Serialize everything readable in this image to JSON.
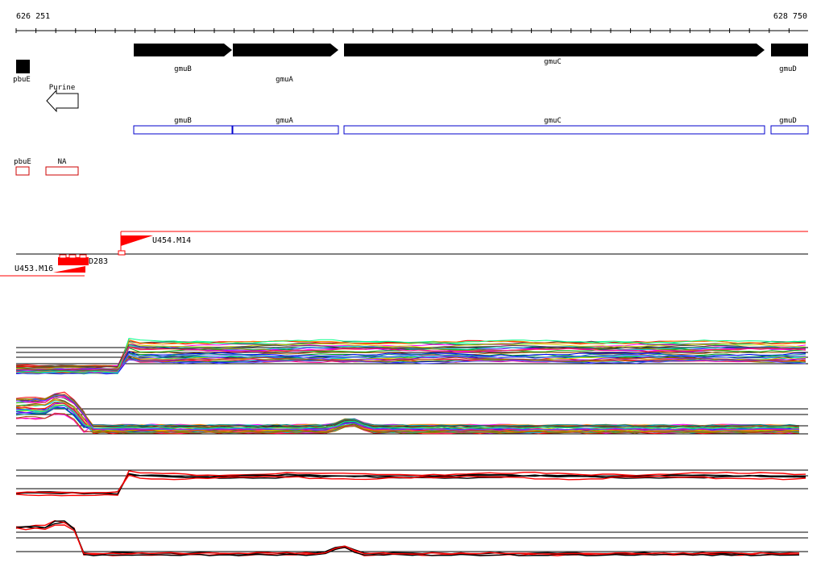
{
  "coordinates": {
    "start": "626 251",
    "end": "628 750"
  },
  "genes": [
    "gmuB",
    "gmuA",
    "gmuC",
    "gmuD",
    "pbuE"
  ],
  "riboswitch": {
    "label": "Purine"
  },
  "operon_labels": [
    "gmuB",
    "gmuA",
    "gmuC",
    "gmuD"
  ],
  "terminators": [
    "pbuE",
    "NA"
  ],
  "probes": {
    "forward": "U454.M14",
    "reverse": "U453.M16",
    "small": "D283"
  },
  "colors": {
    "gene": "#000000",
    "operon_box": "#0000cc",
    "terminator": "#cc0000",
    "probe": "#ff0000",
    "axis": "#000000"
  },
  "expression_panels": [
    {
      "name": "forward-strand-all-conditions",
      "profile_shape": "step-up"
    },
    {
      "name": "reverse-strand-all-conditions",
      "profile_shape": "peak-down"
    },
    {
      "name": "forward-strand-selected",
      "profile_shape": "step-up"
    },
    {
      "name": "reverse-strand-selected",
      "profile_shape": "peak-down"
    }
  ]
}
